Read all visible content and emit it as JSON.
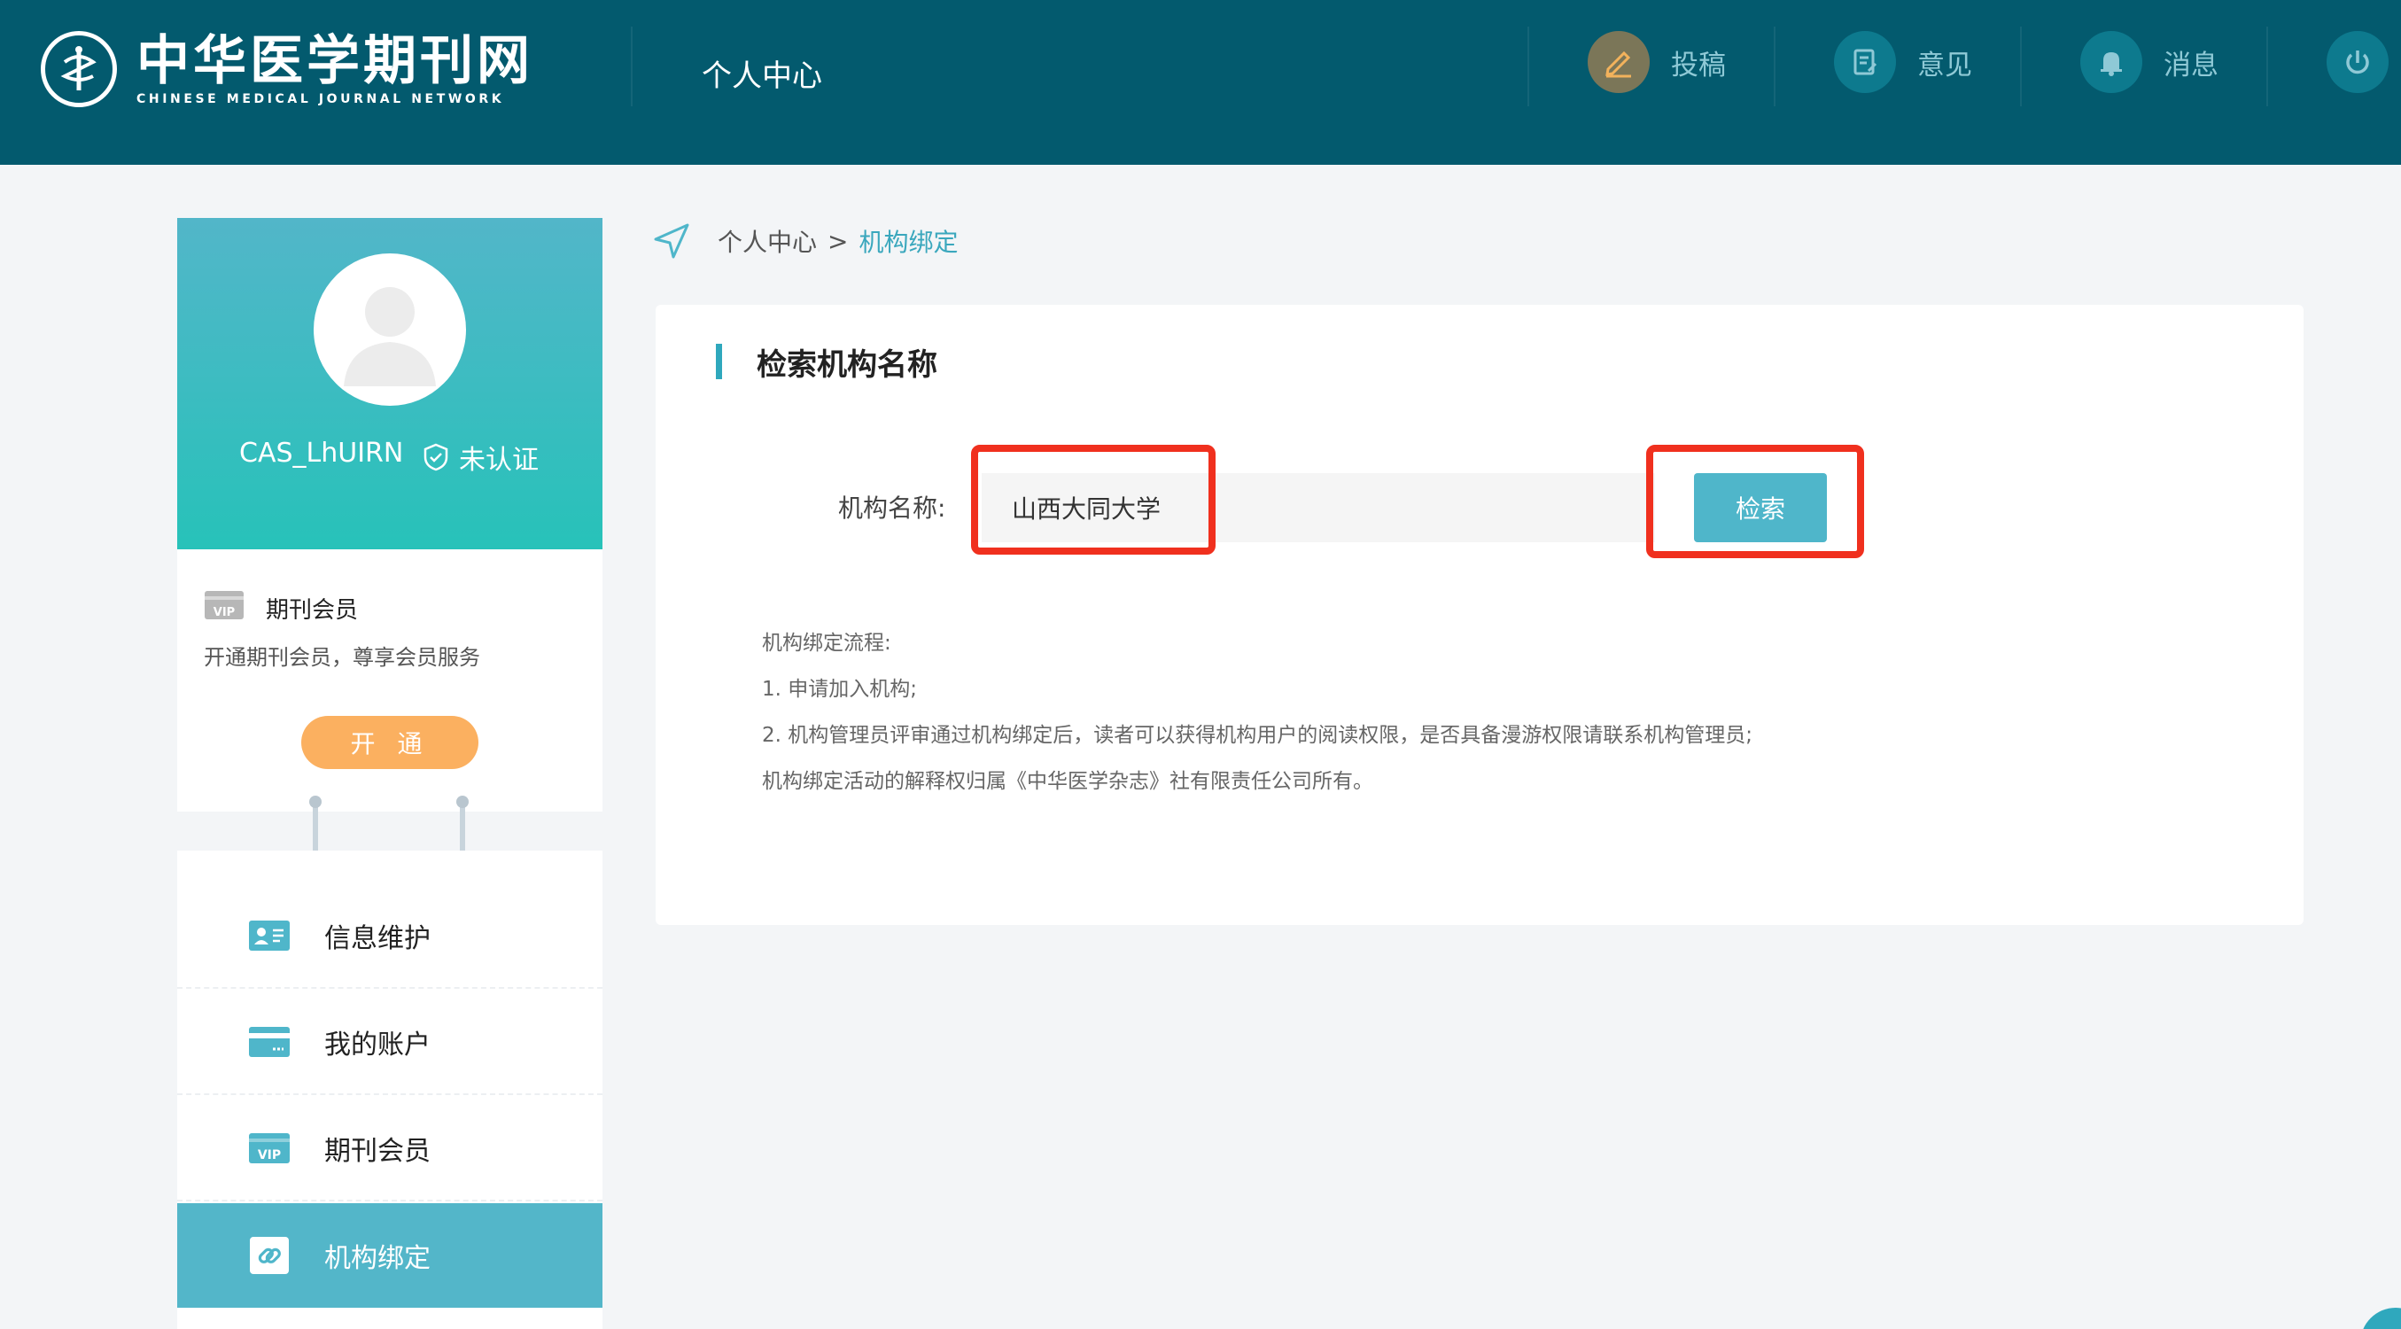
{
  "header": {
    "logo_cn": "中华医学期刊网",
    "logo_en": "CHINESE MEDICAL JOURNAL NETWORK",
    "title": "个人中心",
    "nav": [
      {
        "label": "投稿",
        "icon": "edit-pen-icon"
      },
      {
        "label": "意见",
        "icon": "feedback-icon"
      },
      {
        "label": "消息",
        "icon": "bell-icon"
      },
      {
        "label": "",
        "icon": "power-icon"
      }
    ]
  },
  "profile": {
    "username": "CAS_LhUIRN",
    "cert_status": "未认证"
  },
  "vip": {
    "title": "期刊会员",
    "desc": "开通期刊会员，尊享会员服务",
    "button": "开 通"
  },
  "menu": {
    "items": [
      {
        "label": "信息维护",
        "icon": "id-card-icon"
      },
      {
        "label": "我的账户",
        "icon": "credit-card-icon"
      },
      {
        "label": "期刊会员",
        "icon": "vip-icon"
      },
      {
        "label": "机构绑定",
        "icon": "link-icon"
      }
    ]
  },
  "breadcrumb": {
    "root": "个人中心",
    "separator": ">",
    "current": "机构绑定"
  },
  "panel": {
    "title": "检索机构名称",
    "field_label": "机构名称:",
    "input_value": "山西大同大学",
    "search_button": "检索",
    "notes": [
      "机构绑定流程:",
      "1. 申请加入机构;",
      "2. 机构管理员评审通过机构绑定后，读者可以获得机构用户的阅读权限，是否具备漫游权限请联系机构管理员;",
      "机构绑定活动的解释权归属《中华医学杂志》社有限责任公司所有。"
    ]
  },
  "colors": {
    "header_bg": "#035a6e",
    "accent": "#53b6c9",
    "highlight": "#f0301e",
    "open_button": "#fbb060"
  }
}
